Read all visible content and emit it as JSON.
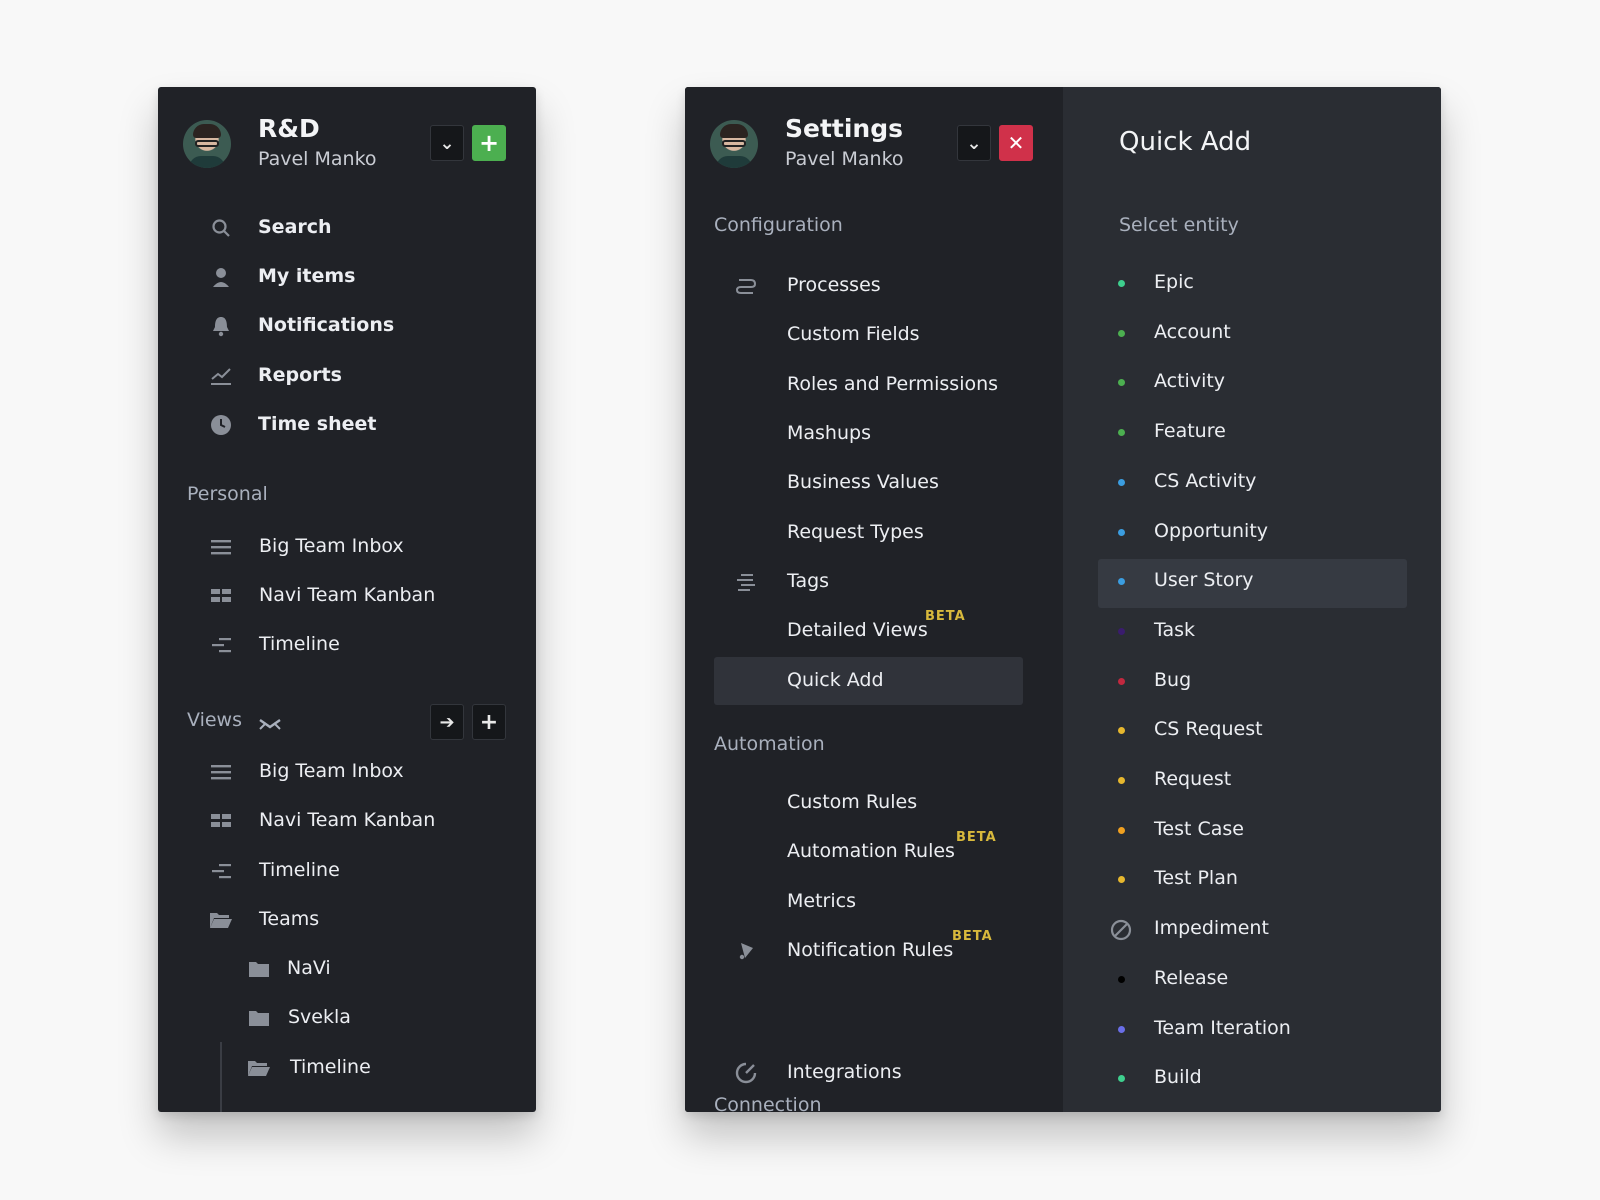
{
  "left": {
    "title": "R&D",
    "user": "Pavel Manko",
    "nav": [
      {
        "label": "Search",
        "icon": "search-icon"
      },
      {
        "label": "My items",
        "icon": "user-icon"
      },
      {
        "label": "Notifications",
        "icon": "bell-icon"
      },
      {
        "label": "Reports",
        "icon": "chart-icon"
      },
      {
        "label": "Time sheet",
        "icon": "clock-icon"
      }
    ],
    "personal_label": "Personal",
    "personal": [
      {
        "label": "Big Team Inbox",
        "icon": "list-icon"
      },
      {
        "label": "Navi Team Kanban",
        "icon": "kanban-icon"
      },
      {
        "label": "Timeline",
        "icon": "timeline-icon"
      }
    ],
    "views_label": "Views",
    "views": [
      {
        "label": "Big Team Inbox",
        "icon": "list-icon"
      },
      {
        "label": "Navi Team Kanban",
        "icon": "kanban-icon"
      },
      {
        "label": "Timeline",
        "icon": "timeline-icon"
      },
      {
        "label": "Teams",
        "icon": "folder-open-icon"
      }
    ],
    "teams": [
      {
        "label": "NaVi",
        "icon": "folder-icon"
      },
      {
        "label": "Svekla",
        "icon": "folder-icon"
      },
      {
        "label": "Timeline",
        "icon": "folder-open-icon"
      }
    ]
  },
  "settings": {
    "title": "Settings",
    "user": "Pavel Manko",
    "configuration_label": "Configuration",
    "configuration": [
      {
        "label": "Processes",
        "icon": "processes-icon"
      },
      {
        "label": "Custom Fields"
      },
      {
        "label": "Roles and Permissions"
      },
      {
        "label": "Mashups"
      },
      {
        "label": "Business Values"
      },
      {
        "label": "Request Types"
      },
      {
        "label": "Tags",
        "icon": "tags-icon"
      },
      {
        "label": "Detailed Views",
        "badge": "BETA"
      },
      {
        "label": "Quick Add",
        "selected": true
      }
    ],
    "automation_label": "Automation",
    "automation": [
      {
        "label": "Custom Rules"
      },
      {
        "label": "Automation Rules",
        "badge": "BETA"
      },
      {
        "label": "Metrics"
      },
      {
        "label": "Notification Rules",
        "badge": "BETA",
        "icon": "bell-icon"
      }
    ],
    "connection_label": "Connection",
    "connection": [
      {
        "label": "Integrations",
        "icon": "integrations-icon"
      }
    ]
  },
  "quick_add": {
    "title": "Quick Add",
    "select_label": "Selcet entity",
    "entities": [
      {
        "label": "Epic",
        "color": "#3ecf8e"
      },
      {
        "label": "Account",
        "color": "#4caf50"
      },
      {
        "label": "Activity",
        "color": "#4caf50"
      },
      {
        "label": "Feature",
        "color": "#4caf50"
      },
      {
        "label": "CS Activity",
        "color": "#3b9de0"
      },
      {
        "label": "Opportunity",
        "color": "#3b9de0"
      },
      {
        "label": "User Story",
        "color": "#3b9de0",
        "selected": true
      },
      {
        "label": "Task",
        "color": "#3a1c6e"
      },
      {
        "label": "Bug",
        "color": "#c2283f"
      },
      {
        "label": "CS Request",
        "color": "#e6b72e"
      },
      {
        "label": "Request",
        "color": "#e6b72e"
      },
      {
        "label": "Test Case",
        "color": "#f0a020"
      },
      {
        "label": "Test Plan",
        "color": "#e6b72e"
      },
      {
        "label": "Impediment",
        "color": "#8a8f98",
        "icon": "blocked-icon"
      },
      {
        "label": "Release",
        "color": "#000000"
      },
      {
        "label": "Team Iteration",
        "color": "#6a6ee8"
      },
      {
        "label": "Build",
        "color": "#3ecf8e"
      }
    ]
  }
}
